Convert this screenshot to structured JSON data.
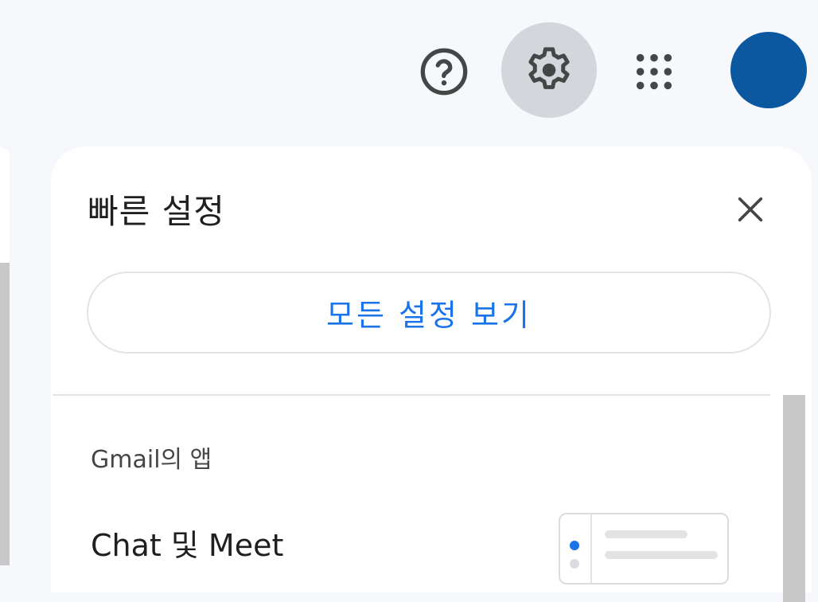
{
  "header": {
    "icons": {
      "help": "help-circle-icon",
      "settings": "gear-icon",
      "apps": "apps-grid-icon",
      "account": "account-avatar"
    },
    "avatar_color": "#0b57a0"
  },
  "quick_settings": {
    "title": "빠른 설정",
    "close_icon": "close-icon",
    "see_all_label": "모든 설정 보기",
    "section_heading": "Gmail의 앱",
    "chat_meet_label": "Chat 및 Meet"
  },
  "colors": {
    "accent": "#1a73e8",
    "background": "#f6f8fc",
    "active_icon_bg": "#d3d6db"
  }
}
